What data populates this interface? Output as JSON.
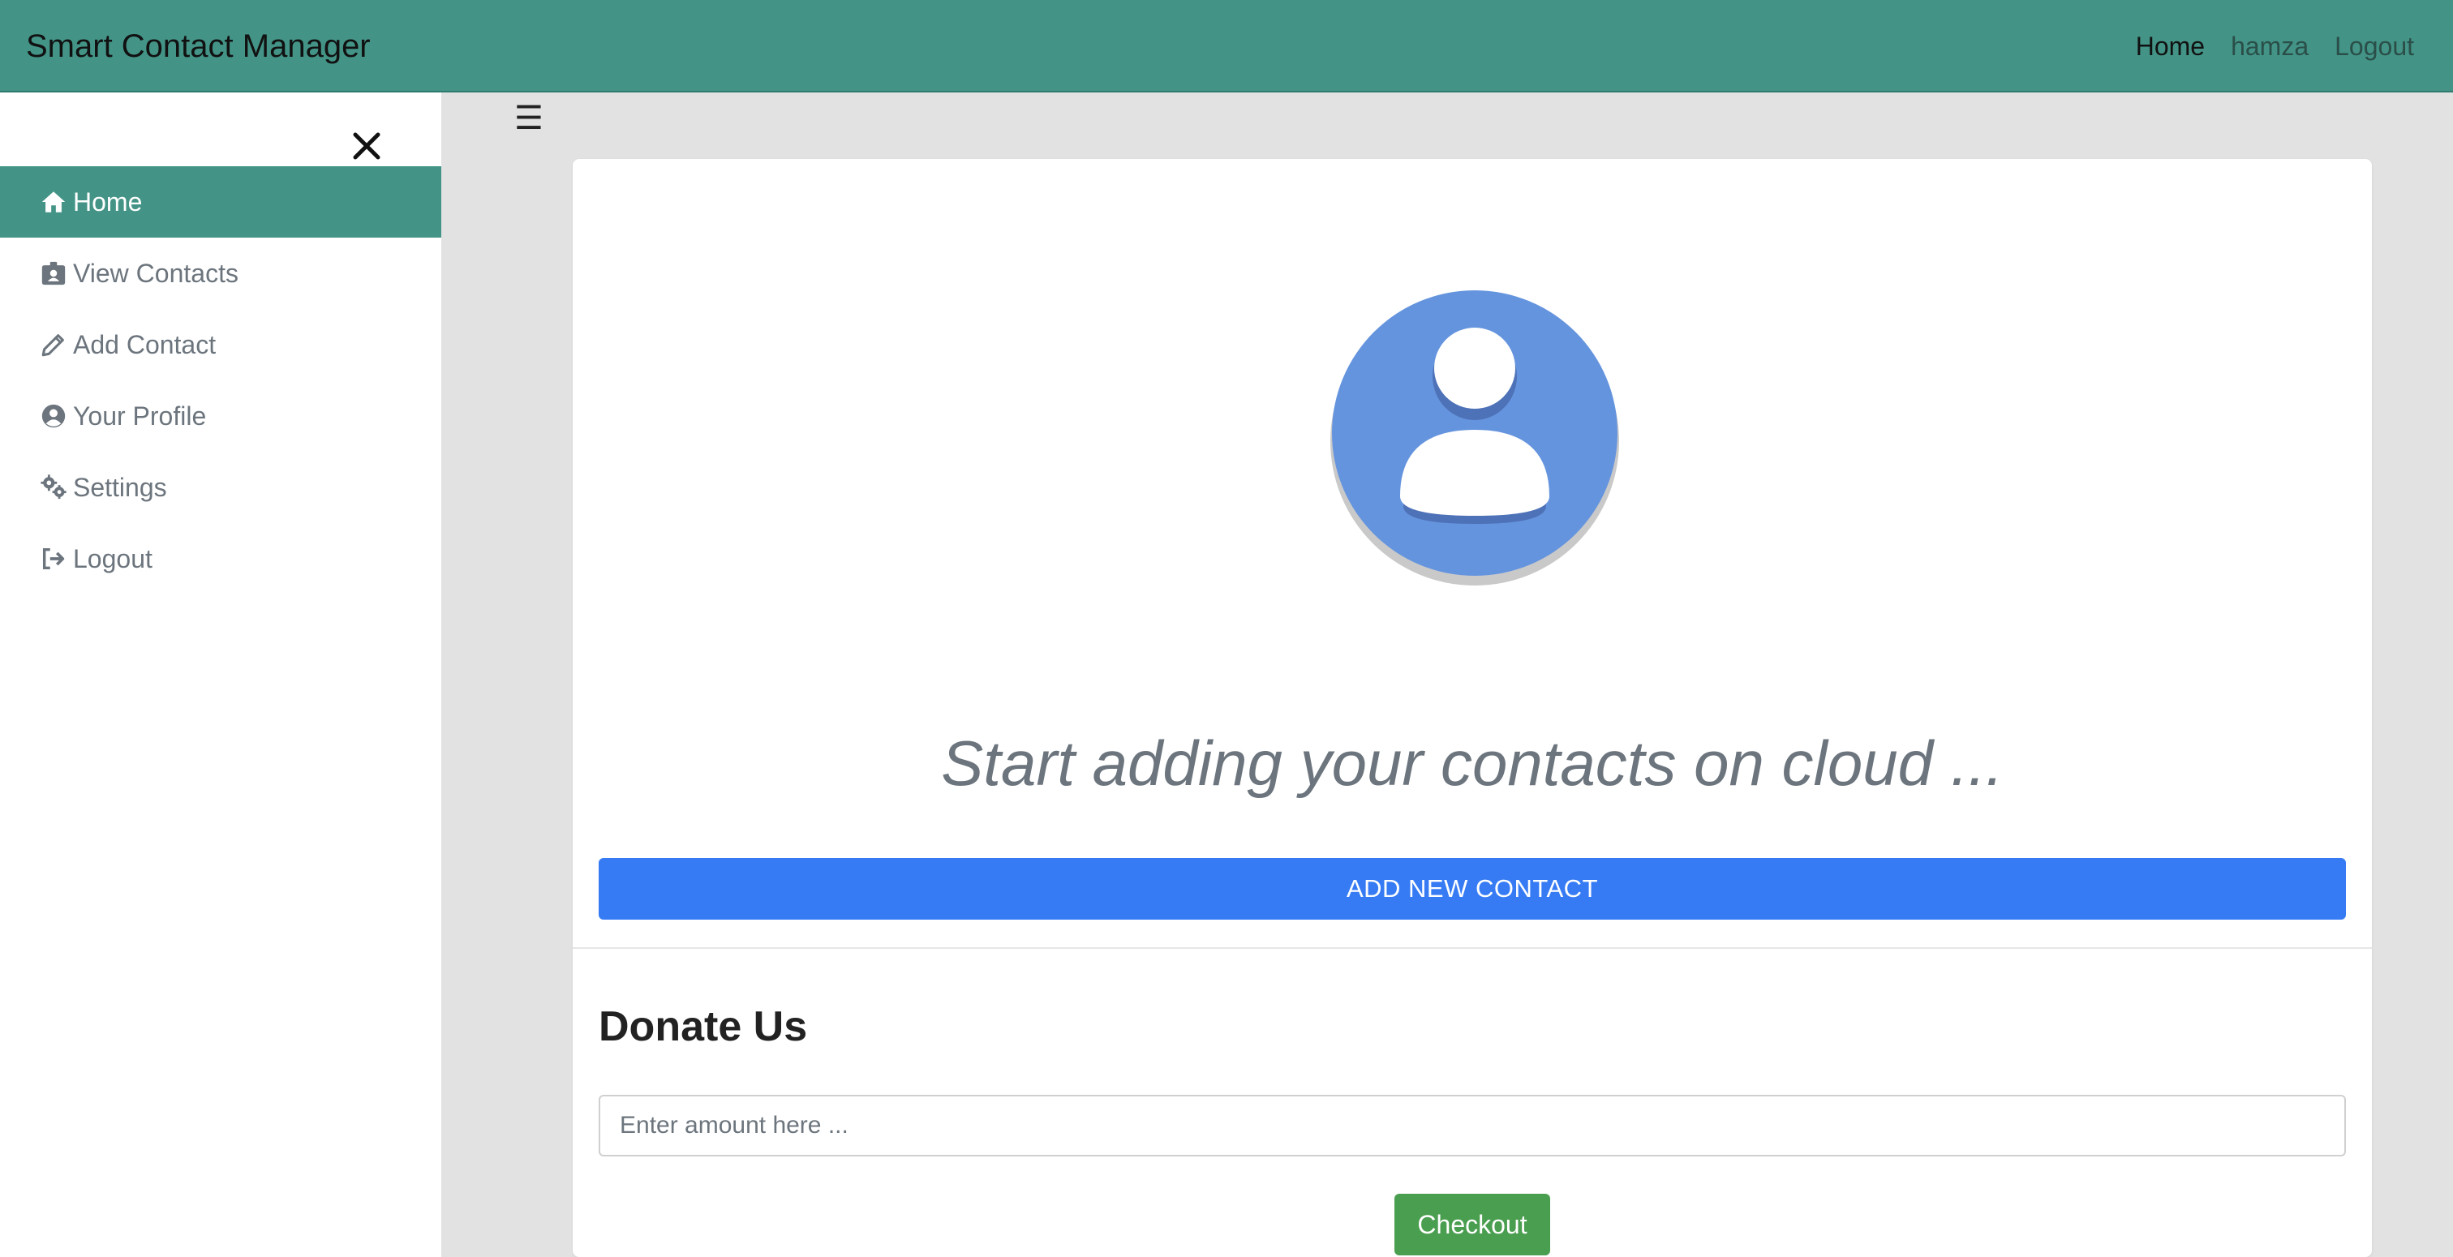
{
  "navbar": {
    "brand": "Smart Contact Manager",
    "links": [
      {
        "label": "Home",
        "active": true
      },
      {
        "label": "hamza",
        "active": false
      },
      {
        "label": "Logout",
        "active": false
      }
    ],
    "background_color": "#439487"
  },
  "sidebar": {
    "close_icon": "close-icon",
    "items": [
      {
        "label": "Home",
        "icon": "home-icon",
        "active": true
      },
      {
        "label": "View Contacts",
        "icon": "id-badge-icon",
        "active": false
      },
      {
        "label": "Add Contact",
        "icon": "pencil-icon",
        "active": false
      },
      {
        "label": "Your Profile",
        "icon": "user-circle-icon",
        "active": false
      },
      {
        "label": "Settings",
        "icon": "cogs-icon",
        "active": false
      },
      {
        "label": "Logout",
        "icon": "sign-out-icon",
        "active": false
      }
    ],
    "active_color": "#439487"
  },
  "main": {
    "menu_toggle": "☰",
    "avatar_icon": "user-avatar-icon",
    "tagline": "Start adding your contacts on cloud ...",
    "add_button_label": "ADD NEW CONTACT",
    "donate": {
      "title": "Donate Us",
      "amount_placeholder": "Enter amount here ...",
      "checkout_label": "Checkout"
    },
    "colors": {
      "primary": "#367bf4",
      "success": "#4a9e4f",
      "avatar": "#6594de"
    }
  }
}
